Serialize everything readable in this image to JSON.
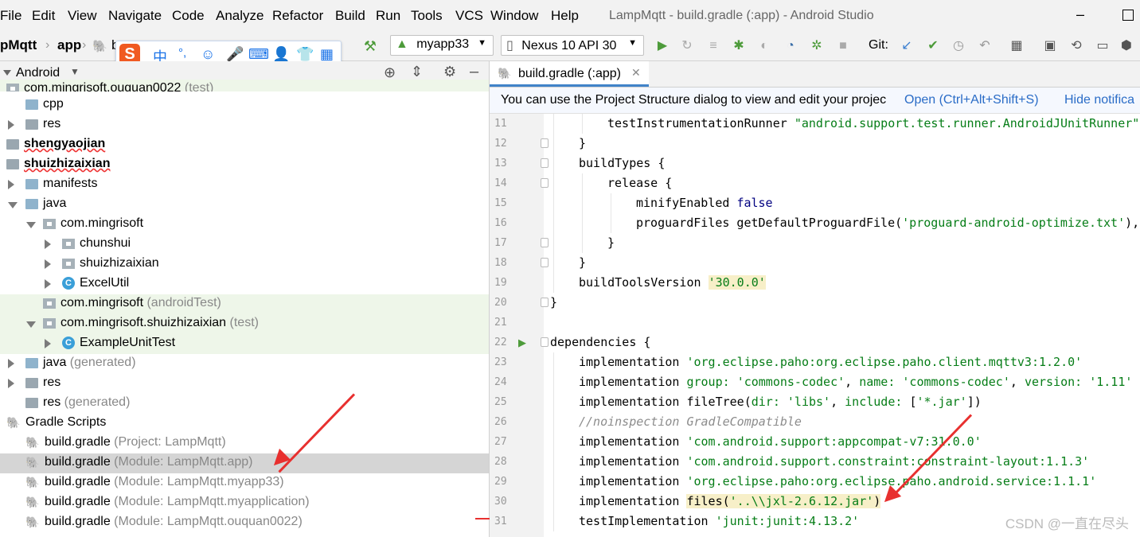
{
  "menubar": {
    "items": [
      "File",
      "Edit",
      "View",
      "Navigate",
      "Code",
      "Analyze",
      "Refactor",
      "Build",
      "Run",
      "Tools",
      "VCS",
      "Window",
      "Help"
    ],
    "window_title": "LampMqtt - build.gradle (:app) - Android Studio"
  },
  "toolbar": {
    "crumb_project": "pMqtt",
    "crumb_module": "app",
    "crumb_file": "b",
    "config": "myapp33",
    "device": "Nexus 10 API 30",
    "git_label": "Git:"
  },
  "ime": {
    "logo": "S",
    "mode": "中",
    "punct": "°,"
  },
  "project_panel": {
    "view_mode": "Android",
    "tree": [
      {
        "label": "com.mingrisoft.ouquan0022",
        "sub": " (test)",
        "icon": "pkg",
        "indent": 0,
        "arrow": "none",
        "hl": true,
        "partial": true
      },
      {
        "label": "cpp",
        "sub": "",
        "icon": "folder",
        "indent": 1,
        "arrow": "none"
      },
      {
        "label": "res",
        "sub": "",
        "icon": "folder-res",
        "indent": 1,
        "arrow": "right"
      },
      {
        "label": "shengyaojian",
        "sub": "",
        "icon": "module",
        "indent": 0,
        "arrow": "none",
        "bold": true
      },
      {
        "label": "shuizhizaixian",
        "sub": "",
        "icon": "module",
        "indent": 0,
        "arrow": "none",
        "bold": true
      },
      {
        "label": "manifests",
        "sub": "",
        "icon": "folder",
        "indent": 1,
        "arrow": "right"
      },
      {
        "label": "java",
        "sub": "",
        "icon": "folder",
        "indent": 1,
        "arrow": "down"
      },
      {
        "label": "com.mingrisoft",
        "sub": "",
        "icon": "pkg",
        "indent": 2,
        "arrow": "down"
      },
      {
        "label": "chunshui",
        "sub": "",
        "icon": "pkg",
        "indent": 3,
        "arrow": "right"
      },
      {
        "label": "shuizhizaixian",
        "sub": "",
        "icon": "pkg",
        "indent": 3,
        "arrow": "right"
      },
      {
        "label": "ExcelUtil",
        "sub": "",
        "icon": "class",
        "indent": 3,
        "arrow": "right"
      },
      {
        "label": "com.mingrisoft",
        "sub": " (androidTest)",
        "icon": "pkg",
        "indent": 2,
        "arrow": "none",
        "hl": true
      },
      {
        "label": "com.mingrisoft.shuizhizaixian",
        "sub": " (test)",
        "icon": "pkg",
        "indent": 2,
        "arrow": "down",
        "hl": true
      },
      {
        "label": "ExampleUnitTest",
        "sub": "",
        "icon": "class",
        "indent": 3,
        "arrow": "right",
        "hl": true
      },
      {
        "label": "java",
        "sub": " (generated)",
        "icon": "folder-gen",
        "indent": 1,
        "arrow": "right"
      },
      {
        "label": "res",
        "sub": "",
        "icon": "folder-res",
        "indent": 1,
        "arrow": "right"
      },
      {
        "label": "res",
        "sub": " (generated)",
        "icon": "folder-res",
        "indent": 1,
        "arrow": "none"
      },
      {
        "label": "Gradle Scripts",
        "sub": "",
        "icon": "gradle",
        "indent": 0,
        "arrow": "none"
      },
      {
        "label": "build.gradle",
        "sub": " (Project: LampMqtt)",
        "icon": "gradle",
        "indent": 1,
        "arrow": "none"
      },
      {
        "label": "build.gradle",
        "sub": " (Module: LampMqtt.app)",
        "icon": "gradle",
        "indent": 1,
        "arrow": "none",
        "sel": true
      },
      {
        "label": "build.gradle",
        "sub": " (Module: LampMqtt.myapp33)",
        "icon": "gradle",
        "indent": 1,
        "arrow": "none"
      },
      {
        "label": "build.gradle",
        "sub": " (Module: LampMqtt.myapplication)",
        "icon": "gradle",
        "indent": 1,
        "arrow": "none"
      },
      {
        "label": "build.gradle",
        "sub": " (Module: LampMqtt.ouquan0022)",
        "icon": "gradle",
        "indent": 1,
        "arrow": "none"
      }
    ]
  },
  "editor": {
    "tab_label": "build.gradle (:app)",
    "notice_text": "You can use the Project Structure dialog to view and edit your projec",
    "notice_open": "Open (Ctrl+Alt+Shift+S)",
    "notice_hide": "Hide notifica",
    "lines": [
      {
        "n": "11",
        "indent": 2,
        "parts": [
          [
            "t",
            "testInstrumentationRunner "
          ],
          [
            "s",
            "\"android.support.test.runner.AndroidJUnitRunner\""
          ]
        ]
      },
      {
        "n": "12",
        "indent": 1,
        "parts": [
          [
            "t",
            "}"
          ]
        ]
      },
      {
        "n": "13",
        "indent": 1,
        "parts": [
          [
            "t",
            "buildTypes {"
          ]
        ]
      },
      {
        "n": "14",
        "indent": 2,
        "parts": [
          [
            "t",
            "release {"
          ]
        ]
      },
      {
        "n": "15",
        "indent": 3,
        "parts": [
          [
            "t",
            "minifyEnabled "
          ],
          [
            "k",
            "false"
          ]
        ]
      },
      {
        "n": "16",
        "indent": 3,
        "parts": [
          [
            "t",
            "proguardFiles getDefaultProguardFile("
          ],
          [
            "s",
            "'proguard-android-optimize.txt'"
          ],
          [
            "t",
            "),"
          ]
        ]
      },
      {
        "n": "17",
        "indent": 2,
        "parts": [
          [
            "t",
            "}"
          ]
        ]
      },
      {
        "n": "18",
        "indent": 1,
        "parts": [
          [
            "t",
            "}"
          ]
        ]
      },
      {
        "n": "19",
        "indent": 1,
        "parts": [
          [
            "t",
            "buildToolsVersion "
          ],
          [
            "h",
            "'30.0.0'"
          ]
        ]
      },
      {
        "n": "20",
        "indent": 0,
        "parts": [
          [
            "t",
            "}"
          ]
        ]
      },
      {
        "n": "21",
        "indent": 0,
        "parts": []
      },
      {
        "n": "22",
        "indent": 0,
        "parts": [
          [
            "t",
            "dependencies {"
          ]
        ]
      },
      {
        "n": "23",
        "indent": 1,
        "parts": [
          [
            "t",
            "implementation "
          ],
          [
            "s",
            "'org.eclipse.paho:org.eclipse.paho.client.mqttv3:1.2.0'"
          ]
        ]
      },
      {
        "n": "24",
        "indent": 1,
        "parts": [
          [
            "t",
            "implementation "
          ],
          [
            "s",
            "group: "
          ],
          [
            "s",
            "'commons-codec'"
          ],
          [
            "t",
            ", "
          ],
          [
            "s",
            "name: "
          ],
          [
            "s",
            "'commons-codec'"
          ],
          [
            "t",
            ", "
          ],
          [
            "s",
            "version: "
          ],
          [
            "s",
            "'1.11'"
          ]
        ]
      },
      {
        "n": "25",
        "indent": 1,
        "parts": [
          [
            "t",
            "implementation fileTree("
          ],
          [
            "s",
            "dir: "
          ],
          [
            "s",
            "'libs'"
          ],
          [
            "t",
            ", "
          ],
          [
            "s",
            "include: "
          ],
          [
            "t",
            "["
          ],
          [
            "s",
            "'*.jar'"
          ],
          [
            "t",
            "])"
          ]
        ]
      },
      {
        "n": "26",
        "indent": 1,
        "parts": [
          [
            "c",
            "//noinspection GradleCompatible"
          ]
        ]
      },
      {
        "n": "27",
        "indent": 1,
        "parts": [
          [
            "t",
            "implementation "
          ],
          [
            "s",
            "'com.android.support:appcompat-v7:31.0.0'"
          ]
        ]
      },
      {
        "n": "28",
        "indent": 1,
        "parts": [
          [
            "t",
            "implementation "
          ],
          [
            "s",
            "'com.android.support.constraint:constraint-layout:1.1.3'"
          ]
        ]
      },
      {
        "n": "29",
        "indent": 1,
        "parts": [
          [
            "t",
            "implementation "
          ],
          [
            "s",
            "'org.eclipse.paho:org.eclipse.paho.android.service:1.1.1'"
          ]
        ]
      },
      {
        "n": "30",
        "indent": 1,
        "parts": [
          [
            "t",
            "implementation "
          ],
          [
            "h2",
            "files("
          ],
          [
            "hs",
            "'..\\\\jxl-2.6.12.jar'"
          ],
          [
            "h2",
            ")"
          ]
        ]
      },
      {
        "n": "31",
        "indent": 1,
        "parts": [
          [
            "t",
            "testImplementation "
          ],
          [
            "s",
            "'junit:junit:4.13.2'"
          ]
        ]
      }
    ]
  },
  "watermark": "CSDN @一直在尽头",
  "colors": {
    "accent": "#4083c9",
    "arrow": "#e8302f",
    "string": "#067d17",
    "keyword": "#000080"
  }
}
